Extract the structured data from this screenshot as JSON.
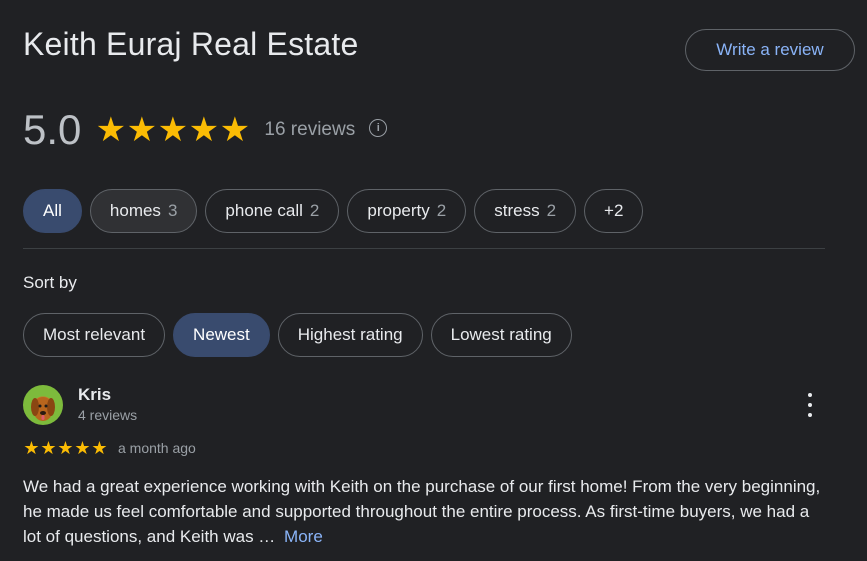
{
  "business": {
    "title": "Keith Euraj Real Estate",
    "write_review_label": "Write a review"
  },
  "rating": {
    "value": "5.0",
    "stars": 5,
    "review_count_label": "16 reviews",
    "info_icon": "info-icon"
  },
  "topics": [
    {
      "label": "All",
      "count": ""
    },
    {
      "label": "homes",
      "count": "3"
    },
    {
      "label": "phone call",
      "count": "2"
    },
    {
      "label": "property",
      "count": "2"
    },
    {
      "label": "stress",
      "count": "2"
    },
    {
      "label": "+2",
      "count": ""
    }
  ],
  "sort": {
    "label": "Sort by",
    "options": [
      "Most relevant",
      "Newest",
      "Highest rating",
      "Lowest rating"
    ],
    "selected": "Newest"
  },
  "review": {
    "name": "Kris",
    "sub": "4 reviews",
    "stars": 5,
    "time": "a month ago",
    "text": "We had a great experience working with Keith on the purchase of our first home! From the very beginning, he made us feel comfortable and supported throughout the entire process. As first-time buyers, we had a lot of questions, and Keith was …",
    "more_label": "More"
  },
  "colors": {
    "background": "#202124",
    "star": "#fbbc04",
    "accent_link": "#8ab4f8",
    "selected_chip": "#394b6e"
  }
}
